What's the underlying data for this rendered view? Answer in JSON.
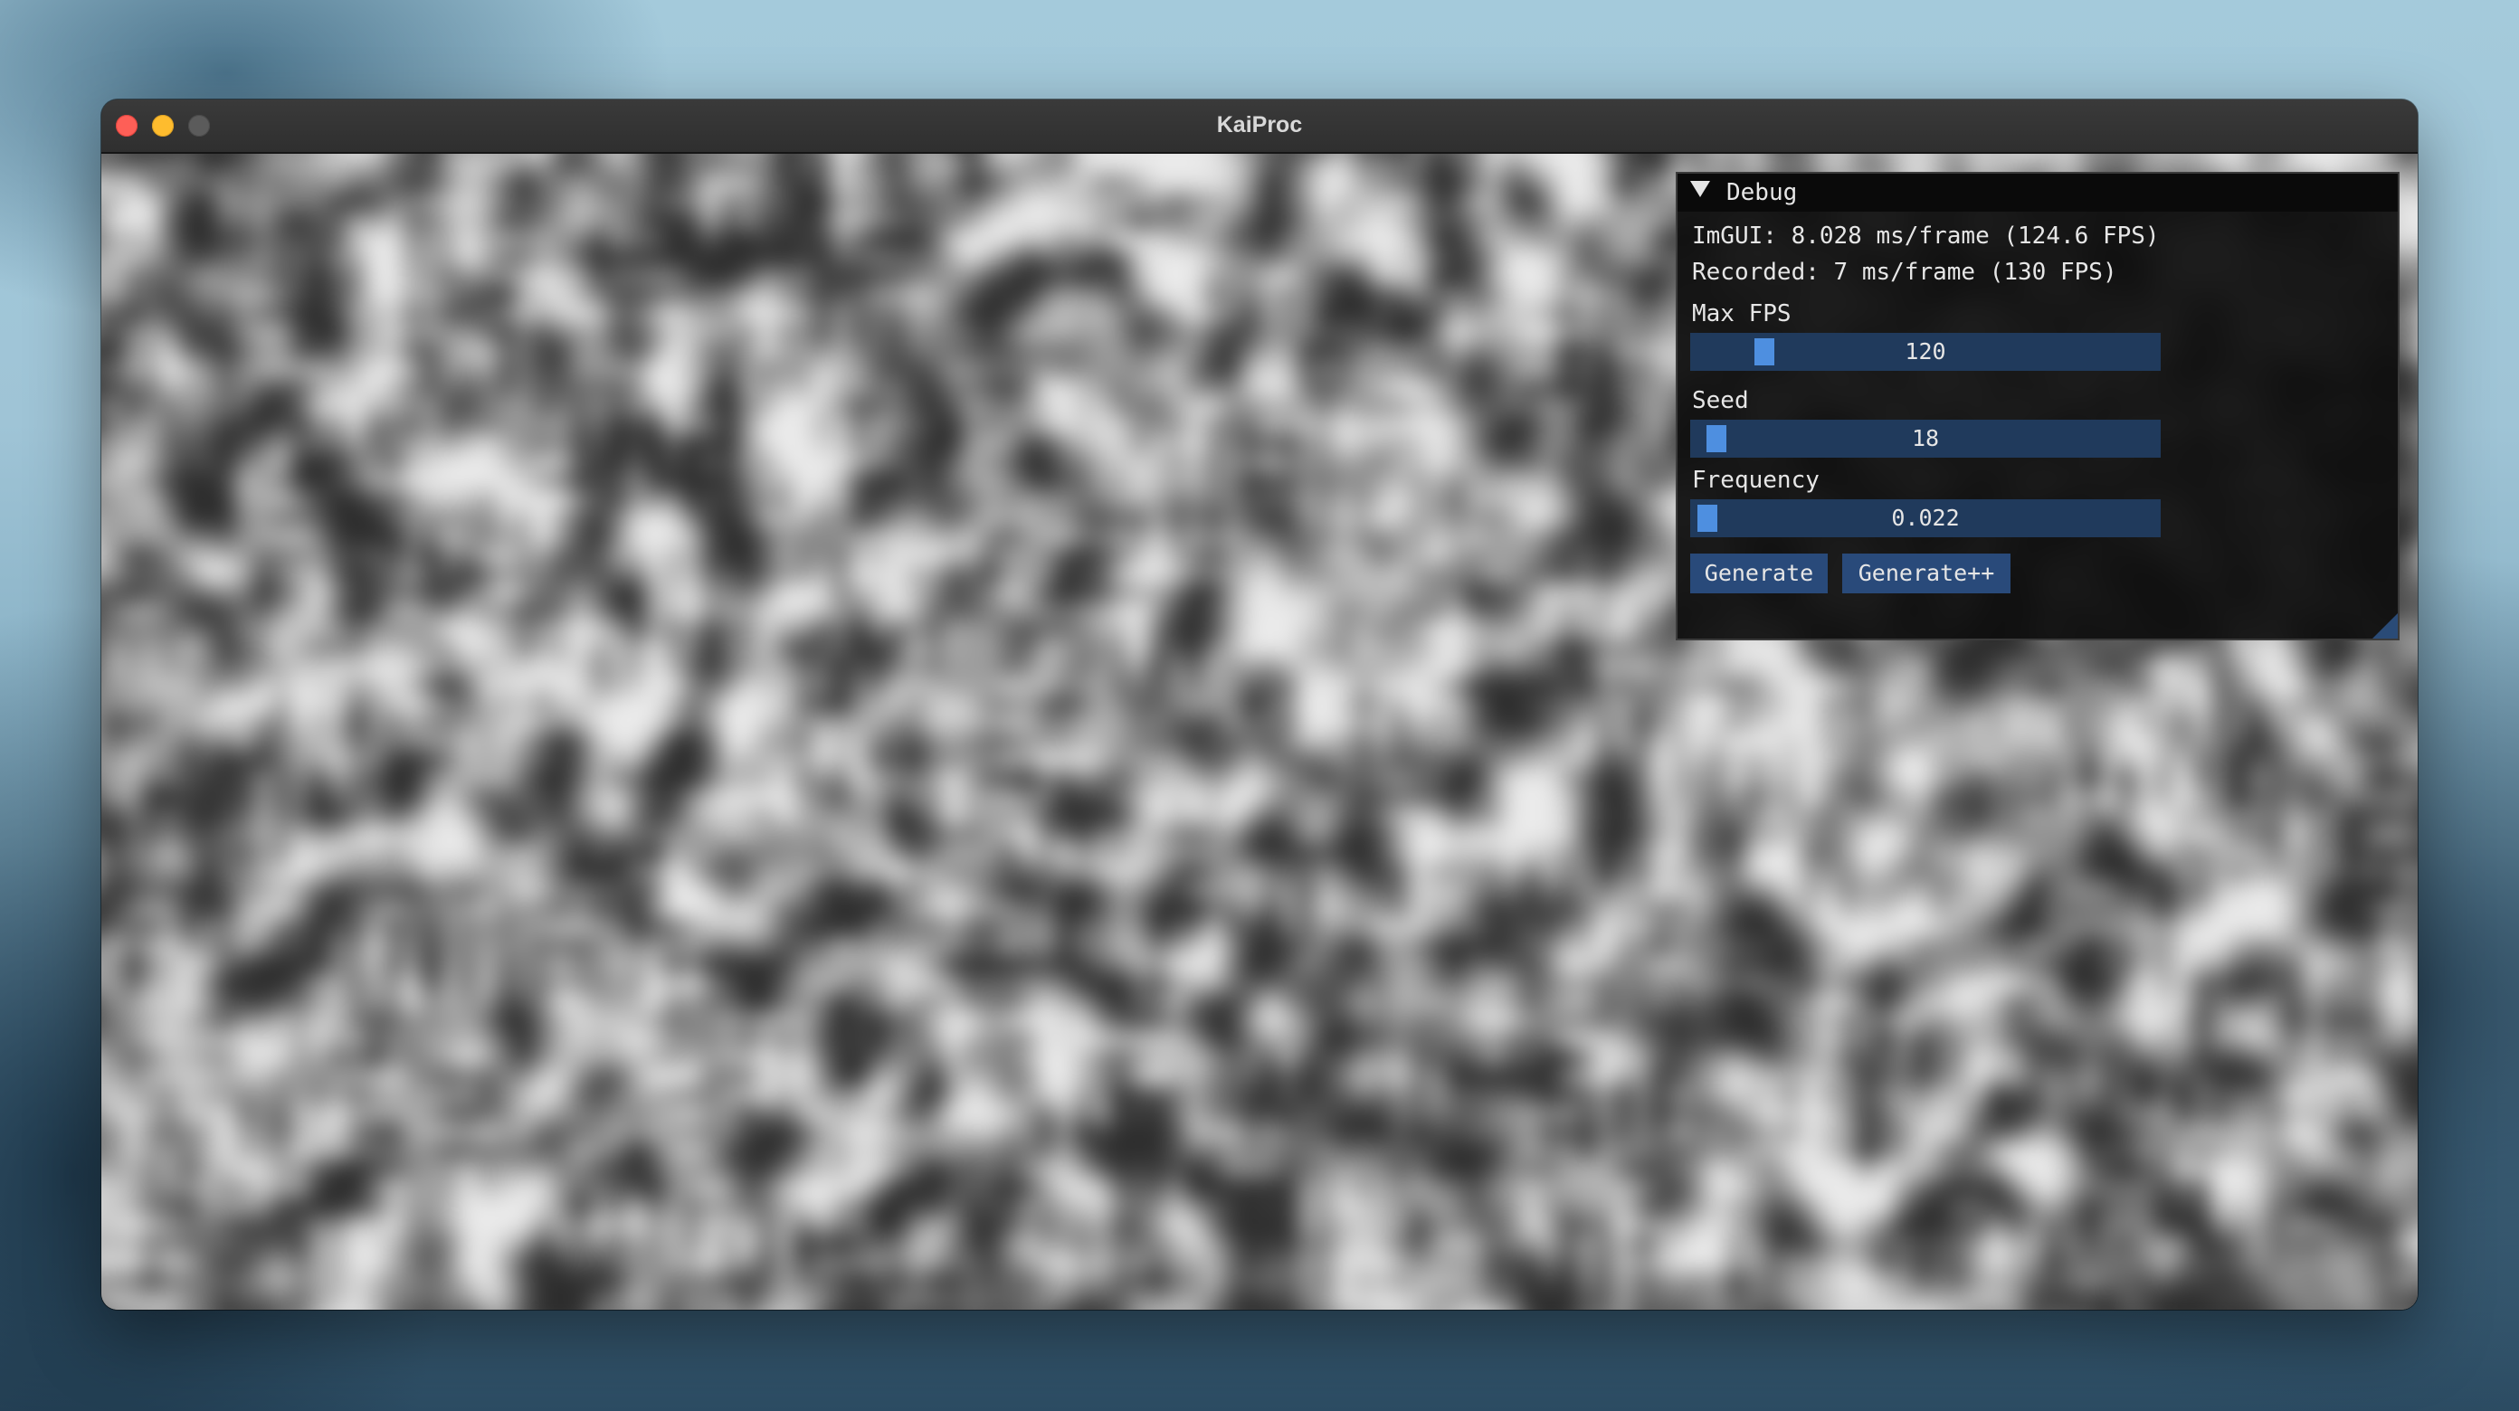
{
  "window": {
    "title": "KaiProc"
  },
  "debug_panel": {
    "title": "Debug",
    "imgui_stats": "ImGUI: 8.028 ms/frame (124.6 FPS)",
    "recorded_stats": "Recorded: 7 ms/frame (130 FPS)",
    "max_fps": {
      "label": "Max FPS",
      "value": "120",
      "fraction": 0.13
    },
    "seed": {
      "label": "Seed",
      "value": "18",
      "fraction": 0.02
    },
    "frequency": {
      "label": "Frequency",
      "value": "0.022",
      "fraction": 0.0
    },
    "buttons": {
      "generate": "Generate",
      "generate_plus": "Generate++"
    }
  },
  "colors": {
    "slider_bg": "#203a5c",
    "slider_grab": "#4e8fe0",
    "button_bg": "#294a7a",
    "close": "#fe5f57",
    "minimize": "#febc2e",
    "maximize_disabled": "#5b5b5b"
  },
  "icons": {
    "collapse": "triangle-down-icon"
  }
}
